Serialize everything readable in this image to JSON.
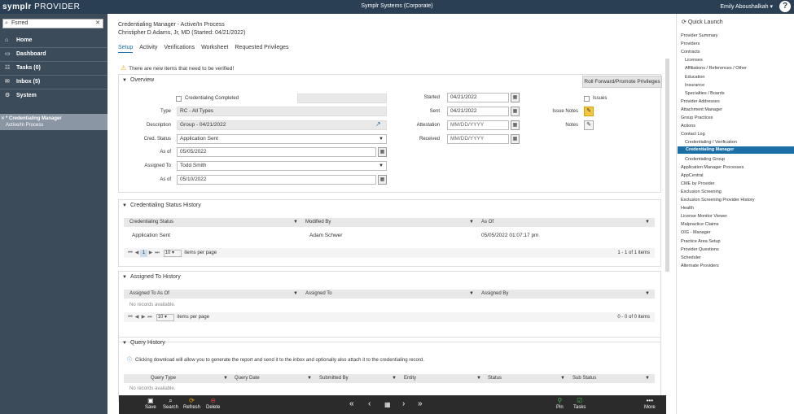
{
  "topbar": {
    "brand_a": "symplr",
    "brand_b": "PROVIDER",
    "org": "Symplr Systems (Corporate)",
    "user": "Emily Aboushalkah ▾",
    "help": "?"
  },
  "leftnav": {
    "search_value": "Fsrred",
    "items": [
      {
        "label": "Home",
        "icon": "⌂"
      },
      {
        "label": "Dashboard",
        "icon": "▭"
      },
      {
        "label": "Tasks (0)",
        "icon": "☷"
      },
      {
        "label": "Inbox (5)",
        "icon": "✉"
      },
      {
        "label": "System",
        "icon": "⚙"
      }
    ],
    "active_line1": "* Credentialing Manager",
    "active_line2": "Active/In Process"
  },
  "header": {
    "title": "Credentialing Manager - Active/In Process",
    "subtitle": "Christipher D Adams, Jr, MD (Started: 04/21/2022)"
  },
  "tabs": [
    "Setup",
    "Activity",
    "Verifications",
    "Worksheet",
    "Requested Privileges"
  ],
  "notice": "There are new items that need to be verified!",
  "overview": {
    "title": "Overview",
    "roll_btn": "Roll Forward/Promote Privileges",
    "cred_completed": "Credentialing Completed",
    "type_label": "Type",
    "type_value": "RC - All Types",
    "desc_label": "Description",
    "desc_value": "Group - 04/21/2022",
    "status_label": "Cred. Status",
    "status_value": "Application Sent",
    "asof_label": "As of",
    "asof_value": "05/05/2022",
    "assigned_label": "Assigned To",
    "assigned_value": "Todd Smith",
    "asof2_label": "As of",
    "asof2_value": "05/10/2022",
    "started_label": "Started",
    "started_value": "04/21/2022",
    "sent_label": "Sent",
    "sent_value": "04/21/2022",
    "attest_label": "Attestation",
    "attest_value": "MM/DD/YYYY",
    "received_label": "Received",
    "received_value": "MM/DD/YYYY",
    "issues_label": "Issues",
    "issue_notes_label": "Issue Notes",
    "notes_label": "Notes"
  },
  "status_history": {
    "title": "Credentialing Status History",
    "columns": [
      "Credentialing Status",
      "Modified By",
      "As Of"
    ],
    "row": [
      "Application Sent",
      "Adam Schwer",
      "05/05/2022 01:07:17 pm"
    ],
    "page": "1",
    "page_size": "10",
    "items_per_page": "items per page",
    "count": "1 - 1 of 1 items"
  },
  "assigned_history": {
    "title": "Assigned To History",
    "columns": [
      "Assigned To As Of",
      "Assigned To",
      "Assigned By"
    ],
    "empty": "No records available.",
    "page_size": "10",
    "items_per_page": "items per page",
    "count": "0 - 0 of 0 items"
  },
  "query_history": {
    "title": "Query History",
    "info": "Clicking download will allow you to generate the report and send it to the inbox and optionally also attach it to the credentialing record.",
    "columns": [
      "Query Type",
      "Query Date",
      "Submitted By",
      "Entity",
      "Status",
      "Sub Status"
    ],
    "empty": "No records available."
  },
  "quick_launch": {
    "title": "Quick Launch",
    "items": [
      {
        "label": "Provider Summary",
        "sub": false
      },
      {
        "label": "Providers",
        "sub": false
      },
      {
        "label": "Contracts",
        "sub": false
      },
      {
        "label": "Licenses",
        "sub": true
      },
      {
        "label": "Affiliations / References / Other",
        "sub": true
      },
      {
        "label": "Education",
        "sub": true
      },
      {
        "label": "Insurance",
        "sub": true
      },
      {
        "label": "Specialties / Boards",
        "sub": true
      },
      {
        "label": "Provider Addresses",
        "sub": false
      },
      {
        "label": "Attachment Manager",
        "sub": false
      },
      {
        "label": "Group Practices",
        "sub": false
      },
      {
        "label": "Actions",
        "sub": false
      },
      {
        "label": "Contact Log",
        "sub": false
      },
      {
        "label": "Credentialing / Verification",
        "sub": true
      },
      {
        "label": "Credentialing Manager",
        "sub": true,
        "active": true
      },
      {
        "label": "Credentialing Group",
        "sub": true
      },
      {
        "label": "Application Manager Processes",
        "sub": false
      },
      {
        "label": "AppCentral",
        "sub": false
      },
      {
        "label": "CME by Provider",
        "sub": false
      },
      {
        "label": "Exclusion Screening",
        "sub": false
      },
      {
        "label": "Exclusion Screening Provider History",
        "sub": false
      },
      {
        "label": "Health",
        "sub": false
      },
      {
        "label": "License Monitor Viewer",
        "sub": false
      },
      {
        "label": "Malpractice Claims",
        "sub": false
      },
      {
        "label": "OIG - Manager",
        "sub": false
      },
      {
        "label": "Practice Area Setup",
        "sub": false
      },
      {
        "label": "Provider Questions",
        "sub": false
      },
      {
        "label": "Scheduler",
        "sub": false
      },
      {
        "label": "Alternate Providers",
        "sub": false
      }
    ]
  },
  "bottombar": {
    "save": "Save",
    "search": "Search",
    "refresh": "Refresh",
    "delete": "Delete",
    "pin": "Pin",
    "tasks": "Tasks",
    "more": "More"
  }
}
